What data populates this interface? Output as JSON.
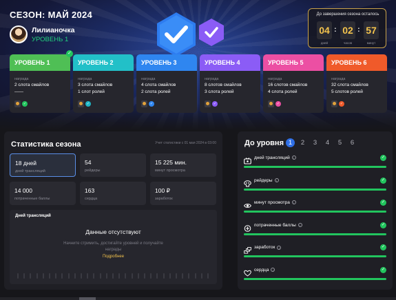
{
  "season": {
    "title": "СЕЗОН: МАЙ 2024"
  },
  "user": {
    "name": "Лилианочка",
    "level": "УРОВЕНЬ 1"
  },
  "timer": {
    "title": "До завершения сезона осталось",
    "days": "04",
    "hours": "02",
    "minutes": "57",
    "days_label": "дней",
    "hours_label": "часов",
    "minutes_label": "минут"
  },
  "levels": [
    {
      "title": "УРОВЕНЬ 1",
      "reward_label": "награда",
      "line1": "2 слота смайлов",
      "line2": "——",
      "color": "#4fbf55",
      "badge_color": "#22c55e",
      "completed": true
    },
    {
      "title": "УРОВЕНЬ 2",
      "reward_label": "награда",
      "line1": "3 слота смайлов",
      "line2": "1 слот ролей",
      "color": "#22c0c8",
      "badge_color": "#1fb6c6",
      "completed": false
    },
    {
      "title": "УРОВЕНЬ 3",
      "reward_label": "награда",
      "line1": "4 слота смайлов",
      "line2": "2 слота ролей",
      "color": "#2f86f0",
      "badge_color": "#2f86f0",
      "completed": false
    },
    {
      "title": "УРОВЕНЬ 4",
      "reward_label": "награда",
      "line1": "8 слотов смайлов",
      "line2": "3 слота ролей",
      "color": "#8b5cf6",
      "badge_color": "#8b5cf6",
      "completed": false
    },
    {
      "title": "УРОВЕНЬ 5",
      "reward_label": "награда",
      "line1": "16 слотов смайлов",
      "line2": "4 слота ролей",
      "color": "#ec4fa3",
      "badge_color": "#ec4fa3",
      "completed": false
    },
    {
      "title": "УРОВЕНЬ 6",
      "reward_label": "награда",
      "line1": "32 слота смайлов",
      "line2": "5 слотов ролей",
      "color": "#f05a2a",
      "badge_color": "#f05a2a",
      "completed": false
    }
  ],
  "stats": {
    "title": "Статистика сезона",
    "note": "Учет статистики с 01 мая 2024 в 03:00",
    "cards": [
      {
        "value": "18 дней",
        "label": "дней трансляций",
        "active": true
      },
      {
        "value": "54",
        "label": "рейдеры",
        "active": false
      },
      {
        "value": "15 225 мин.",
        "label": "минут просмотра",
        "active": false
      },
      {
        "value": "14 000",
        "label": "потраченные баллы",
        "active": false
      },
      {
        "value": "163",
        "label": "сердца",
        "active": false
      },
      {
        "value": "100 ₽",
        "label": "заработок",
        "active": false
      }
    ],
    "chart": {
      "title": "Дней трансляций",
      "empty_title": "Данные отсутствуют",
      "empty_desc": "Начните стримить, достигайте уровней и получайте награды",
      "more_link": "Подробнее"
    }
  },
  "next_level": {
    "title": "До уровня",
    "steps": [
      "1",
      "2",
      "3",
      "4",
      "5",
      "6"
    ],
    "active_step": "1",
    "requirements": [
      {
        "label": "дней трансляций",
        "icon": "broadcast-icon",
        "progress": 1.0
      },
      {
        "label": "рейдеры",
        "icon": "raiders-icon",
        "progress": 1.0
      },
      {
        "label": "минут просмотра",
        "icon": "eye-icon",
        "progress": 1.0
      },
      {
        "label": "потраченные баллы",
        "icon": "points-icon",
        "progress": 1.0
      },
      {
        "label": "заработок",
        "icon": "money-icon",
        "progress": 1.0
      },
      {
        "label": "сердца",
        "icon": "heart-icon",
        "progress": 1.0
      }
    ]
  }
}
